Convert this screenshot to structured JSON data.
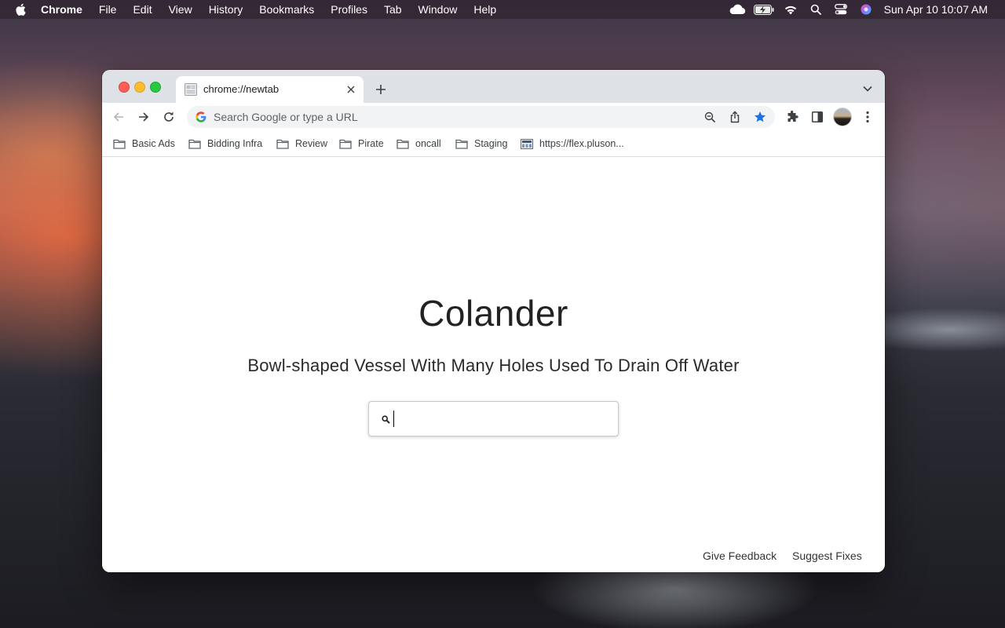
{
  "menubar": {
    "app_name": "Chrome",
    "items": [
      "File",
      "Edit",
      "View",
      "History",
      "Bookmarks",
      "Profiles",
      "Tab",
      "Window",
      "Help"
    ],
    "clock": "Sun Apr 10  10:07 AM",
    "status_icons": [
      "cloud-icon",
      "battery-charging-icon",
      "wifi-icon",
      "spotlight-search-icon",
      "control-center-icon",
      "siri-icon"
    ]
  },
  "browser": {
    "tab": {
      "title": "chrome://newtab"
    },
    "omnibox": {
      "placeholder": "Search Google or type a URL"
    },
    "bookmarks": [
      "Basic Ads",
      "Bidding Infra",
      "Review",
      "Pirate",
      "oncall",
      "Staging",
      "https://flex.pluson..."
    ]
  },
  "page": {
    "title": "Colander",
    "subtitle": "Bowl-shaped Vessel With Many Holes Used To Drain Off Water",
    "search_value": "",
    "footer": {
      "feedback": "Give Feedback",
      "fixes": "Suggest Fixes"
    }
  },
  "colors": {
    "traffic_red": "#ff5f57",
    "traffic_yellow": "#febc2e",
    "traffic_green": "#28c840",
    "bookmark_star": "#1a73e8",
    "tabstrip_bg": "#dee1e6"
  }
}
